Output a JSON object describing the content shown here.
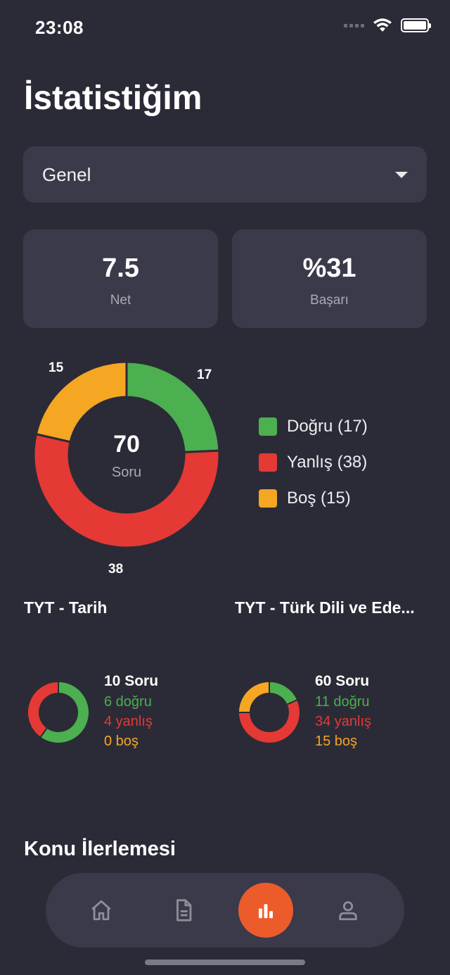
{
  "status_bar": {
    "time": "23:08"
  },
  "page": {
    "title": "İstatistiğim"
  },
  "filter": {
    "selected": "Genel"
  },
  "summary": {
    "net": {
      "value": "7.5",
      "label": "Net"
    },
    "success": {
      "value": "%31",
      "label": "Başarı"
    }
  },
  "colors": {
    "correct": "#4caf50",
    "wrong": "#e53935",
    "blank": "#f5a623",
    "accent": "#ec5b2a"
  },
  "chart_data": {
    "type": "pie",
    "total": 70,
    "center_label": "Soru",
    "slices": [
      {
        "name": "Doğru",
        "value": 17,
        "color": "#4caf50",
        "legend": "Doğru (17)"
      },
      {
        "name": "Yanlış",
        "value": 38,
        "color": "#e53935",
        "legend": "Yanlış (38)"
      },
      {
        "name": "Boş",
        "value": 15,
        "color": "#f5a623",
        "legend": "Boş (15)"
      }
    ],
    "legend_position": "right"
  },
  "subjects": [
    {
      "title": "TYT - Tarih",
      "questions": "10 Soru",
      "correct": 6,
      "wrong": 4,
      "blank": 0,
      "correct_text": "6 doğru",
      "wrong_text": "4 yanlış",
      "blank_text": "0 boş"
    },
    {
      "title": "TYT - Türk Dili ve Ede...",
      "questions": "60 Soru",
      "correct": 11,
      "wrong": 34,
      "blank": 15,
      "correct_text": "11 doğru",
      "wrong_text": "34 yanlış",
      "blank_text": "15 boş"
    }
  ],
  "progress_section": {
    "title": "Konu İlerlemesi"
  },
  "tabbar": {
    "items": [
      {
        "icon": "home-icon"
      },
      {
        "icon": "document-icon"
      },
      {
        "icon": "bar-chart-icon",
        "active": true
      },
      {
        "icon": "profile-icon"
      }
    ]
  }
}
